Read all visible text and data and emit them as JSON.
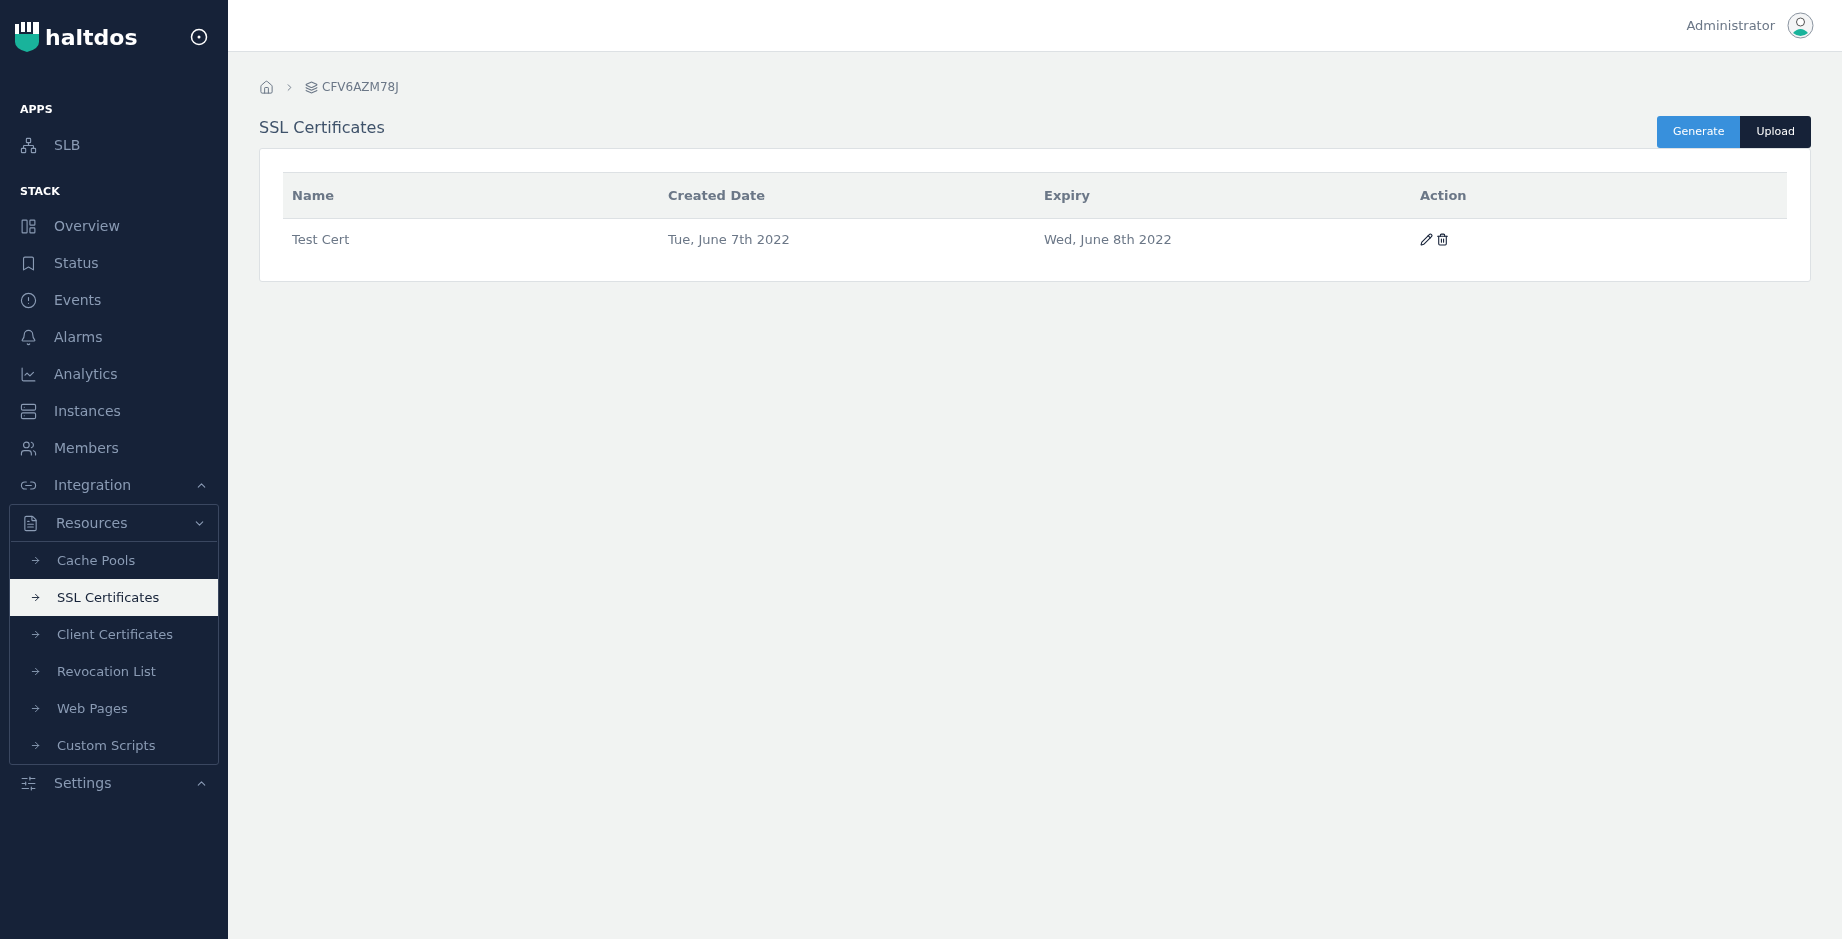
{
  "sidebar": {
    "logo": "haltdos",
    "sections": [
      {
        "title": "APPS",
        "items": [
          {
            "kind": "link",
            "label": "SLB",
            "selected": false
          }
        ]
      },
      {
        "title": "STACK",
        "items": [
          {
            "kind": "link",
            "label": "Overview",
            "selected": false
          },
          {
            "kind": "link",
            "label": "Status",
            "selected": false
          },
          {
            "kind": "link",
            "label": "Events",
            "selected": false
          },
          {
            "kind": "link",
            "label": "Alarms",
            "selected": false
          },
          {
            "kind": "link",
            "label": "Analytics",
            "selected": false
          },
          {
            "kind": "link",
            "label": "Instances",
            "selected": false
          },
          {
            "kind": "link",
            "label": "Members",
            "selected": false
          },
          {
            "kind": "group",
            "label": "Integration",
            "expanded": false
          },
          {
            "kind": "group",
            "label": "Resources",
            "expanded": true,
            "children": [
              {
                "label": "Cache Pools",
                "selected": false
              },
              {
                "label": "SSL Certificates",
                "selected": true
              },
              {
                "label": "Client Certificates",
                "selected": false
              },
              {
                "label": "Revocation List",
                "selected": false
              },
              {
                "label": "Web Pages",
                "selected": false
              },
              {
                "label": "Custom Scripts",
                "selected": false
              }
            ]
          },
          {
            "kind": "group",
            "label": "Settings",
            "expanded": false
          }
        ]
      }
    ]
  },
  "header": {
    "user": "Administrator"
  },
  "breadcrumb": {
    "stack": "CFV6AZM78J"
  },
  "page": {
    "title": "SSL Certificates",
    "buttons": [
      {
        "label": "Generate",
        "kind": "primary"
      },
      {
        "label": "Upload",
        "kind": "dark"
      }
    ]
  },
  "table": {
    "columns": [
      "Name",
      "Created Date",
      "Expiry",
      "Action"
    ],
    "rows": [
      {
        "name": "Test Cert",
        "created": "Tue, June 7th 2022",
        "expiry": "Wed, June 8th 2022"
      }
    ]
  }
}
